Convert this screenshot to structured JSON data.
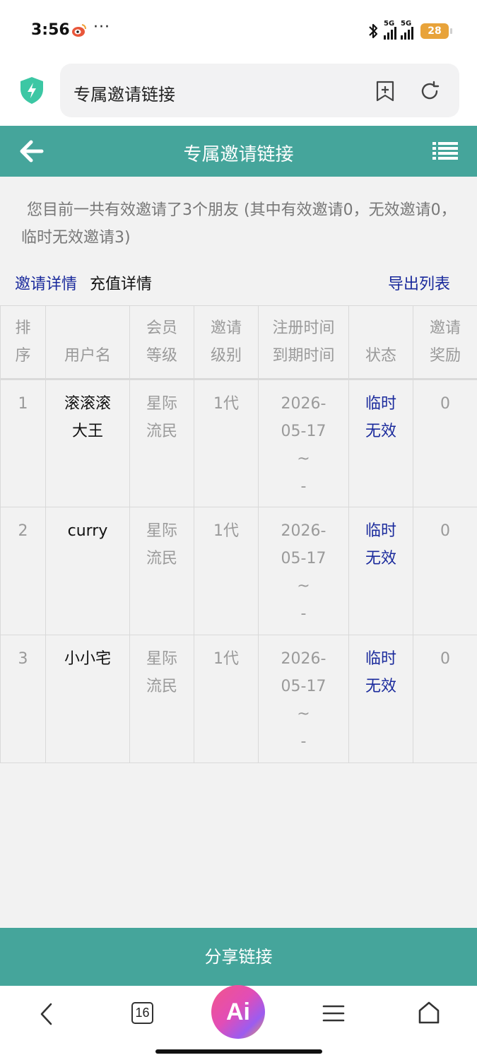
{
  "status_bar": {
    "time": "3:56",
    "more": "···",
    "network_1": "5G",
    "network_2": "5G",
    "battery": "28"
  },
  "browser": {
    "address_text": "专属邀请链接"
  },
  "header": {
    "title": "专属邀请链接"
  },
  "summary": {
    "text": "您目前一共有效邀请了3个朋友 (其中有效邀请0，无效邀请0，临时无效邀请3)"
  },
  "links": {
    "invite_details": "邀请详情",
    "recharge_details": "充值详情",
    "export_list": "导出列表"
  },
  "table": {
    "headers": {
      "rank": [
        "排",
        "序"
      ],
      "username": "用户名",
      "member_level": [
        "会员",
        "等级"
      ],
      "invite_level": [
        "邀请",
        "级别"
      ],
      "time": [
        "注册时间",
        "到期时间"
      ],
      "status": "状态",
      "reward": [
        "邀请",
        "奖励"
      ]
    },
    "rows": [
      {
        "rank": "1",
        "username": [
          "滚滚滚",
          "大王"
        ],
        "member_level": [
          "星际",
          "流民"
        ],
        "invite_level": "1代",
        "time": [
          "2026-",
          "05-17",
          "~",
          "-"
        ],
        "status": [
          "临时",
          "无效"
        ],
        "reward": "0"
      },
      {
        "rank": "2",
        "username": [
          "curry",
          ""
        ],
        "member_level": [
          "星际",
          "流民"
        ],
        "invite_level": "1代",
        "time": [
          "2026-",
          "05-17",
          "~",
          "-"
        ],
        "status": [
          "临时",
          "无效"
        ],
        "reward": "0"
      },
      {
        "rank": "3",
        "username": [
          "小小宅",
          ""
        ],
        "member_level": [
          "星际",
          "流民"
        ],
        "invite_level": "1代",
        "time": [
          "2026-",
          "05-17",
          "~",
          "-"
        ],
        "status": [
          "临时",
          "无效"
        ],
        "reward": "0"
      }
    ]
  },
  "share_button": {
    "label": "分享链接"
  },
  "bottom_nav": {
    "tabs_count": "16",
    "ai_label": "Ai"
  },
  "colors": {
    "accent": "#45a59b",
    "link": "#1a2a9c",
    "battery": "#e8a33a"
  }
}
